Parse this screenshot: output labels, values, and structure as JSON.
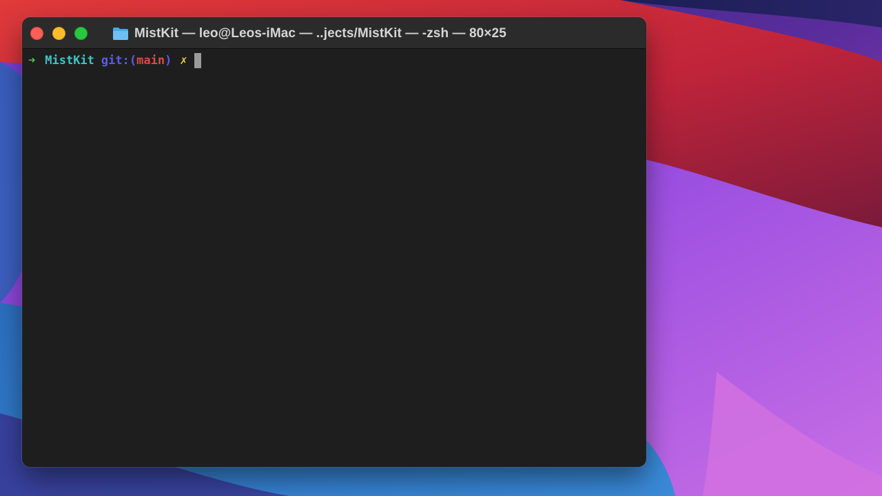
{
  "window": {
    "title": "MistKit — leo@Leos-iMac — ..jects/MistKit — -zsh — 80×25",
    "title_icon": "folder-icon",
    "buttons": {
      "close": "close-button",
      "minimize": "minimize-button",
      "zoom": "zoom-button"
    }
  },
  "terminal": {
    "prompt": {
      "arrow": "➜",
      "directory": "MistKit",
      "git_label": "git:",
      "paren_open": "(",
      "branch": "main",
      "paren_close": ")",
      "dirty_marker": "✗"
    },
    "input": ""
  },
  "colors": {
    "arrow": "#4bc84b",
    "directory": "#3ec5c5",
    "git": "#5b5bf0",
    "branch": "#e04848",
    "dirty": "#e6d33f",
    "terminal_bg": "#1e1e1e",
    "close": "#ff5f57",
    "minimize": "#febc2e",
    "zoom": "#28c840"
  }
}
